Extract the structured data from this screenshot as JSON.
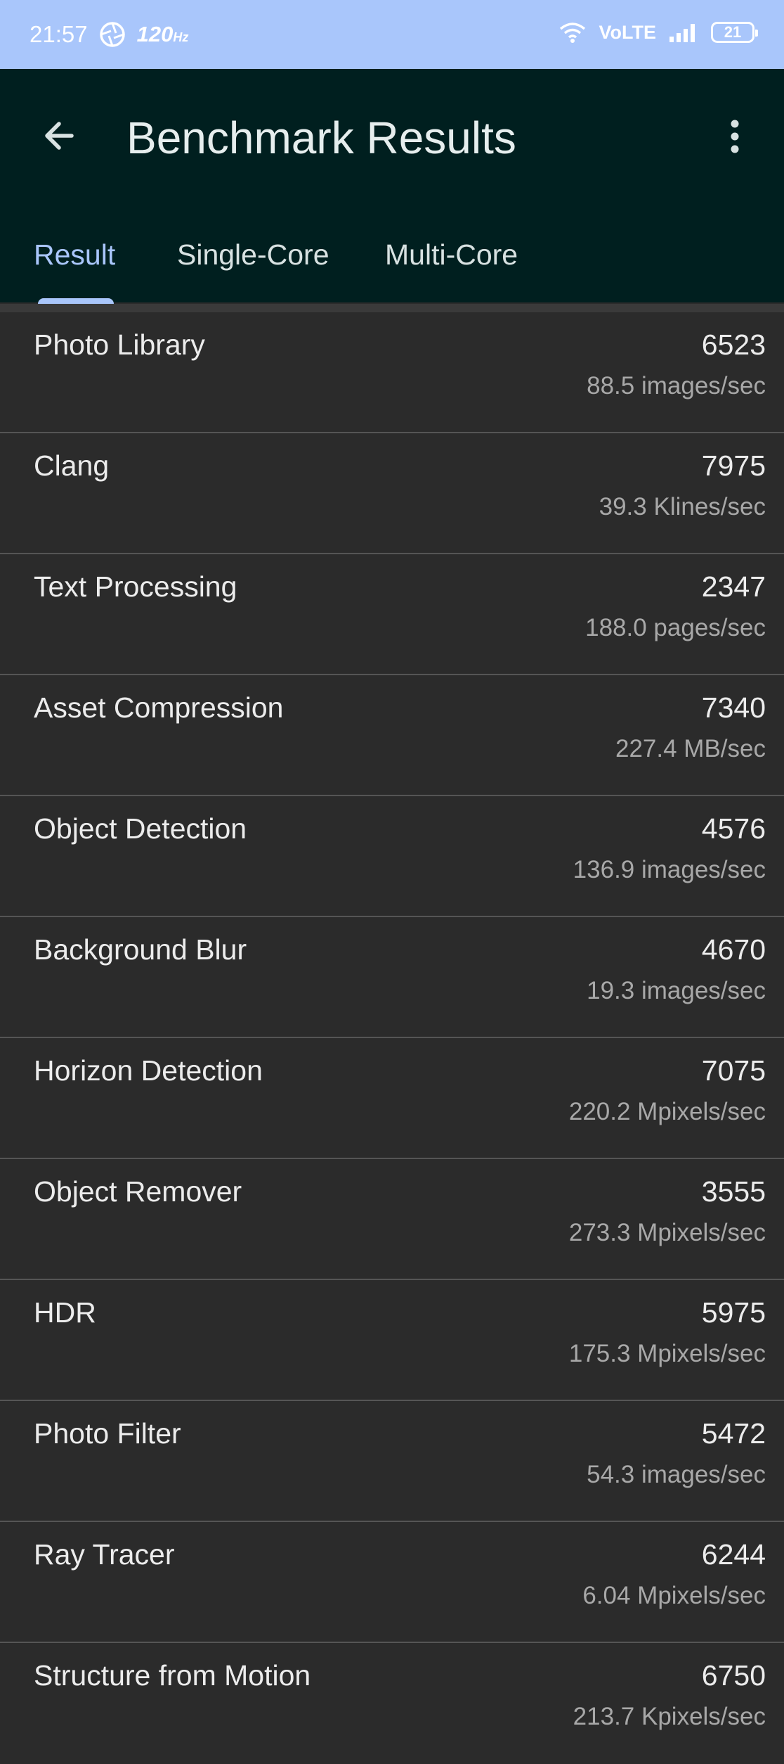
{
  "status_bar": {
    "time": "21:57",
    "refresh_rate": "120",
    "refresh_unit": "Hz",
    "network": "VoLTE",
    "battery": "21"
  },
  "app_bar": {
    "title": "Benchmark Results",
    "back_icon": "arrow-back-icon",
    "menu_icon": "more-vert-icon"
  },
  "tabs": [
    {
      "label": "Result",
      "active": true
    },
    {
      "label": "Single-Core",
      "active": false
    },
    {
      "label": "Multi-Core",
      "active": false
    }
  ],
  "results": [
    {
      "name": "Photo Library",
      "score": "6523",
      "rate": "88.5 images/sec"
    },
    {
      "name": "Clang",
      "score": "7975",
      "rate": "39.3 Klines/sec"
    },
    {
      "name": "Text Processing",
      "score": "2347",
      "rate": "188.0 pages/sec"
    },
    {
      "name": "Asset Compression",
      "score": "7340",
      "rate": "227.4 MB/sec"
    },
    {
      "name": "Object Detection",
      "score": "4576",
      "rate": "136.9 images/sec"
    },
    {
      "name": "Background Blur",
      "score": "4670",
      "rate": "19.3 images/sec"
    },
    {
      "name": "Horizon Detection",
      "score": "7075",
      "rate": "220.2 Mpixels/sec"
    },
    {
      "name": "Object Remover",
      "score": "3555",
      "rate": "273.3 Mpixels/sec"
    },
    {
      "name": "HDR",
      "score": "5975",
      "rate": "175.3 Mpixels/sec"
    },
    {
      "name": "Photo Filter",
      "score": "5472",
      "rate": "54.3 images/sec"
    },
    {
      "name": "Ray Tracer",
      "score": "6244",
      "rate": "6.04 Mpixels/sec"
    },
    {
      "name": "Structure from Motion",
      "score": "6750",
      "rate": "213.7 Kpixels/sec"
    }
  ],
  "colors": {
    "status_bar_bg": "#a9c6fb",
    "app_bar_bg": "#001f1f",
    "accent": "#a9c6fb",
    "list_bg": "#2b2b2b"
  }
}
